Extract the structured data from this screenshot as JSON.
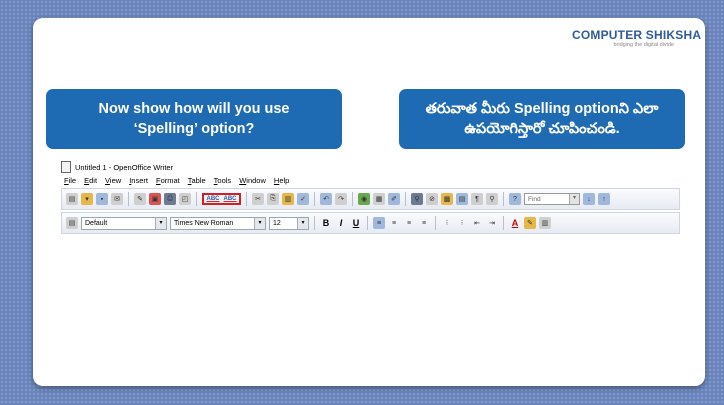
{
  "logo": {
    "title": "COMPUTER SHIKSHA",
    "tagline": "bridging the digital divide"
  },
  "callouts": {
    "english": {
      "line1": "Now show how will you use",
      "line2": "‘Spelling’ option?"
    },
    "telugu": {
      "line1": "తరువాత మీరు Spelling optionని ఎలా",
      "line2": "ఉపయోగిస్తారో చూపించండి."
    }
  },
  "app": {
    "window_title": "Untitled 1 - OpenOffice Writer",
    "menu": [
      "File",
      "Edit",
      "View",
      "Insert",
      "Format",
      "Table",
      "Tools",
      "Window",
      "Help"
    ],
    "find_placeholder": "Find",
    "spelling_label": "ABC",
    "paragraph_style": "Default",
    "font_name": "Times New Roman",
    "font_size": "12",
    "bold": "B",
    "italic": "I",
    "underline": "U",
    "font_color_label": "A"
  },
  "colors": {
    "callout": "#1f6bb3",
    "highlight": "#d61f1f",
    "background": "#6a86bd"
  }
}
